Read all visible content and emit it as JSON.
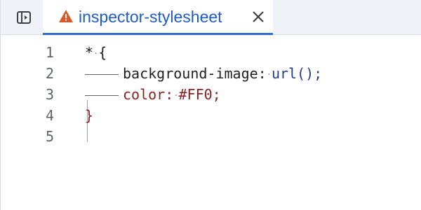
{
  "tab": {
    "title": "inspector-stylesheet"
  },
  "colors": {
    "tab_accent": "#2b6bd6",
    "tab_text": "#1d5bc7",
    "warning": "#d65a2c",
    "property": "#8b1e1e",
    "value": "#243b88",
    "gutter": "#5f6368"
  },
  "icons": {
    "sidebar_toggle": "sidebar-toggle-icon",
    "warning": "warning-icon",
    "close": "close-icon"
  },
  "editor": {
    "line_numbers": [
      "1",
      "2",
      "3",
      "4",
      "5"
    ],
    "lines": [
      {
        "selector": "*",
        "open": "{"
      },
      {
        "property": "background-image:",
        "value": "url();"
      },
      {
        "property": "color:",
        "value": "#FF0;"
      },
      {
        "close": "}"
      },
      {}
    ]
  }
}
